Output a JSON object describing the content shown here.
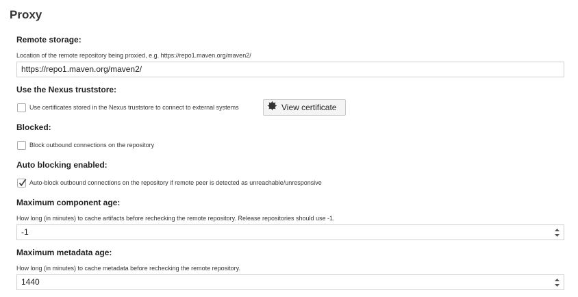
{
  "section": {
    "title": "Proxy"
  },
  "remote_storage": {
    "label": "Remote storage:",
    "help": "Location of the remote repository being proxied, e.g. https://repo1.maven.org/maven2/",
    "value": "https://repo1.maven.org/maven2/"
  },
  "truststore": {
    "label": "Use the Nexus truststore:",
    "checkbox_label": "Use certificates stored in the Nexus truststore to connect to external systems",
    "checked": false,
    "button_label": "View certificate",
    "button_icon": "gear-badge-icon"
  },
  "blocked": {
    "label": "Blocked:",
    "checkbox_label": "Block outbound connections on the repository",
    "checked": false
  },
  "auto_blocking": {
    "label": "Auto blocking enabled:",
    "checkbox_label": "Auto-block outbound connections on the repository if remote peer is detected as unreachable/unresponsive",
    "checked": true
  },
  "max_component_age": {
    "label": "Maximum component age:",
    "help": "How long (in minutes) to cache artifacts before rechecking the remote repository. Release repositories should use -1.",
    "value": "-1"
  },
  "max_metadata_age": {
    "label": "Maximum metadata age:",
    "help": "How long (in minutes) to cache metadata before rechecking the remote repository.",
    "value": "1440"
  },
  "colors": {
    "text": "#333333",
    "border": "#cfcfcf",
    "button_bg": "#f4f4f4"
  }
}
